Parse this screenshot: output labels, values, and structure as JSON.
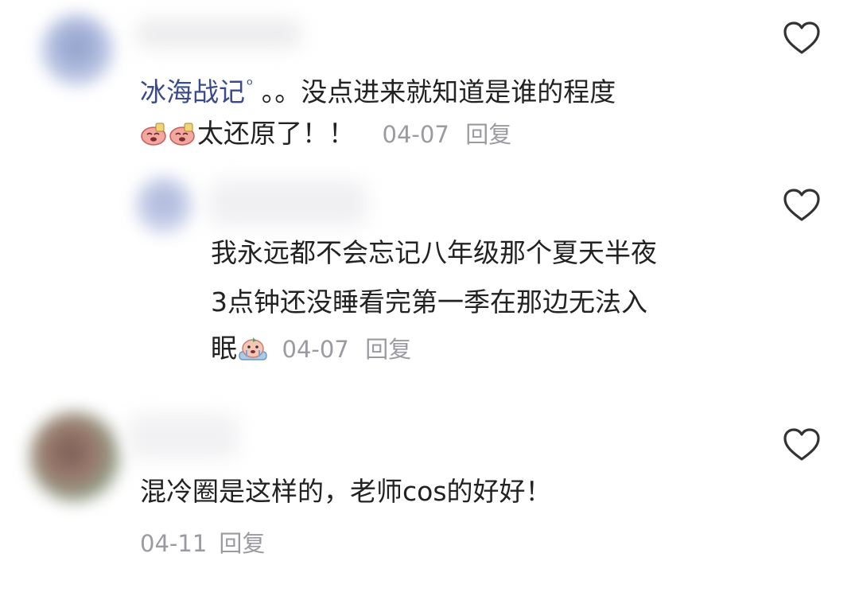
{
  "comments": [
    {
      "mention": "冰海战记",
      "text": "。。没点进来就知道是谁的程度",
      "text2": "太还原了！！",
      "emojis": [
        "pig-laugh-emoji",
        "pig-laugh-emoji"
      ],
      "date": "04-07",
      "reply_label": "回复",
      "liked": false
    },
    {
      "is_reply": true,
      "lines": [
        "我永远都不会忘记八年级那个夏天半夜",
        "3点钟还没睡看完第一季在那边无法入",
        "眠"
      ],
      "emojis": [
        "pig-crying-emoji"
      ],
      "date": "04-07",
      "reply_label": "回复",
      "liked": false
    },
    {
      "text": "混冷圈是这样的，老师cos的好好！",
      "date": "04-11",
      "reply_label": "回复",
      "liked": false
    }
  ],
  "colors": {
    "mention": "#3a4a8c",
    "meta": "#9a9aa0",
    "text": "#222222",
    "heart": "#333333"
  }
}
